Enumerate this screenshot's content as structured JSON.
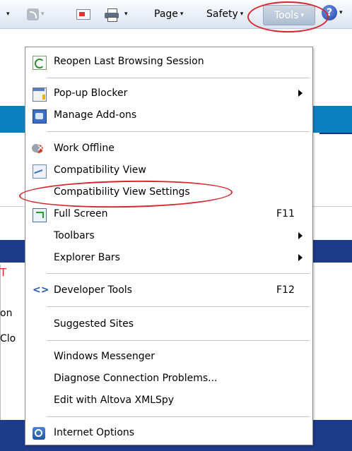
{
  "commandbar": {
    "page_label": "Page",
    "safety_label": "Safety",
    "tools_label": "Tools",
    "help_icon_text": "?",
    "dropdown_arrow": "▾"
  },
  "background": {
    "fragment_red": "T",
    "fragment_line1": "on",
    "fragment_line2": "Clo"
  },
  "menu": {
    "items": [
      {
        "label": "Reopen Last Browsing Session",
        "icon": "reopen-session-icon"
      },
      {
        "label": "Pop-up Blocker",
        "icon": "popup-blocker-icon",
        "submenu": true
      },
      {
        "label": "Manage Add-ons",
        "icon": "manage-addons-icon"
      },
      {
        "label": "Work Offline",
        "icon": "work-offline-icon"
      },
      {
        "label": "Compatibility View",
        "icon": "compatibility-view-icon"
      },
      {
        "label": "Compatibility View Settings"
      },
      {
        "label": "Full Screen",
        "icon": "full-screen-icon",
        "shortcut": "F11"
      },
      {
        "label": "Toolbars",
        "submenu": true
      },
      {
        "label": "Explorer Bars",
        "submenu": true
      },
      {
        "label": "Developer Tools",
        "icon": "developer-tools-icon",
        "shortcut": "F12"
      },
      {
        "label": "Suggested Sites"
      },
      {
        "label": "Windows Messenger"
      },
      {
        "label": "Diagnose Connection Problems..."
      },
      {
        "label": "Edit with Altova XMLSpy"
      },
      {
        "label": "Internet Options",
        "icon": "internet-options-icon"
      }
    ]
  },
  "colors": {
    "annotation_red": "#d8262f",
    "page_blue": "#0b7fc0",
    "page_navy": "#1e3b8a"
  }
}
